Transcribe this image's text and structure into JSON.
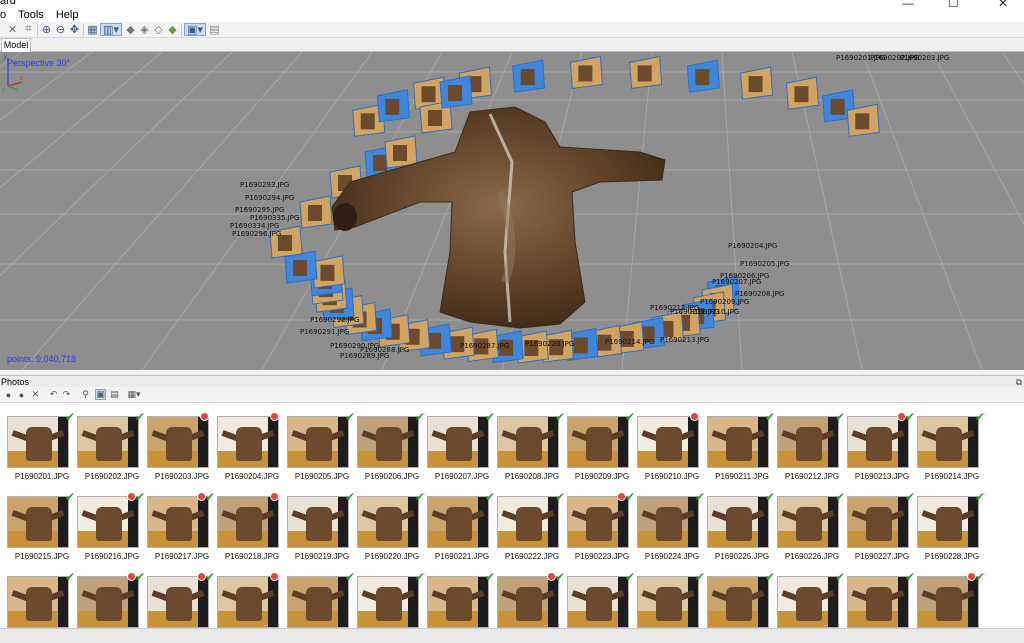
{
  "app": {
    "title_fragment": "ard"
  },
  "menu": [
    "o",
    "Tools",
    "Help"
  ],
  "window_buttons": {
    "minimize": "—",
    "maximize": "☐",
    "close": "✕"
  },
  "tabs": [
    {
      "label": "Model"
    }
  ],
  "viewport": {
    "projection_label": "Perspective 30°",
    "points_label": "points: 9,040,718",
    "camera_labels": [
      "P1690201.JPG",
      "P1690202.JPG",
      "P1690203.JPG",
      "P1690204.JPG",
      "P1690205.JPG",
      "P1690206.JPG",
      "P1690207.JPG",
      "P1690208.JPG",
      "P1690209.JPG",
      "P1690210.JPG",
      "P1690211.JPG",
      "P1690212.JPG",
      "P1690213.JPG",
      "P1690214.JPG",
      "P1690220.JPG",
      "P1690287.JPG",
      "P1690288.JPG",
      "P1690289.JPG",
      "P1690290.JPG",
      "P1690291.JPG",
      "P1690292.JPG",
      "P1690293.JPG",
      "P1690294.JPG",
      "P1690295.JPG",
      "P1690296.JPG",
      "P1690334.JPG",
      "P1690335.JPG"
    ]
  },
  "photos_pane": {
    "title": "Photos",
    "dock_icon": "restore-icon",
    "photos": [
      {
        "name": "P1690201.JPG",
        "status": "aligned"
      },
      {
        "name": "P1690202.JPG",
        "status": "aligned"
      },
      {
        "name": "P1690203.JPG",
        "status": "disabled"
      },
      {
        "name": "P1690204.JPG",
        "status": "disabled"
      },
      {
        "name": "P1690205.JPG",
        "status": "aligned"
      },
      {
        "name": "P1690206.JPG",
        "status": "aligned"
      },
      {
        "name": "P1690207.JPG",
        "status": "aligned"
      },
      {
        "name": "P1690208.JPG",
        "status": "aligned"
      },
      {
        "name": "P1690209.JPG",
        "status": "aligned"
      },
      {
        "name": "P1690210.JPG",
        "status": "disabled"
      },
      {
        "name": "P1690211.JPG",
        "status": "aligned"
      },
      {
        "name": "P1690212.JPG",
        "status": "aligned"
      },
      {
        "name": "P1690213.JPG",
        "status": "disabled-aligned"
      },
      {
        "name": "P1690214.JPG",
        "status": "aligned"
      },
      {
        "name": "P1690215.JPG",
        "status": "aligned"
      },
      {
        "name": "P1690216.JPG",
        "status": "disabled-aligned"
      },
      {
        "name": "P1690217.JPG",
        "status": "disabled-aligned"
      },
      {
        "name": "P1690218.JPG",
        "status": "disabled"
      },
      {
        "name": "P1690219.JPG",
        "status": "aligned"
      },
      {
        "name": "P1690220.JPG",
        "status": "aligned"
      },
      {
        "name": "P1690221.JPG",
        "status": "aligned"
      },
      {
        "name": "P1690222.JPG",
        "status": "aligned"
      },
      {
        "name": "P1690223.JPG",
        "status": "disabled-aligned"
      },
      {
        "name": "P1690224.JPG",
        "status": "aligned"
      },
      {
        "name": "P1690225.JPG",
        "status": "aligned"
      },
      {
        "name": "P1690226.JPG",
        "status": "aligned"
      },
      {
        "name": "P1690227.JPG",
        "status": "aligned"
      },
      {
        "name": "P1690228.JPG",
        "status": "aligned"
      },
      {
        "name": "",
        "status": "aligned"
      },
      {
        "name": "",
        "status": "disabled-aligned"
      },
      {
        "name": "",
        "status": "disabled-aligned"
      },
      {
        "name": "",
        "status": "disabled"
      },
      {
        "name": "",
        "status": "aligned"
      },
      {
        "name": "",
        "status": "aligned"
      },
      {
        "name": "",
        "status": "aligned"
      },
      {
        "name": "",
        "status": "disabled-aligned"
      },
      {
        "name": "",
        "status": "aligned"
      },
      {
        "name": "",
        "status": "aligned"
      },
      {
        "name": "",
        "status": "aligned"
      },
      {
        "name": "",
        "status": "aligned"
      },
      {
        "name": "",
        "status": "aligned"
      },
      {
        "name": "",
        "status": "disabled-aligned"
      }
    ]
  },
  "colors": {
    "viewport_bg": "#8e8e8e",
    "camera_plane": "#4a90e2",
    "coat": "#6b4a2e",
    "ok": "#2aa12a",
    "disabled": "#e0473f"
  }
}
